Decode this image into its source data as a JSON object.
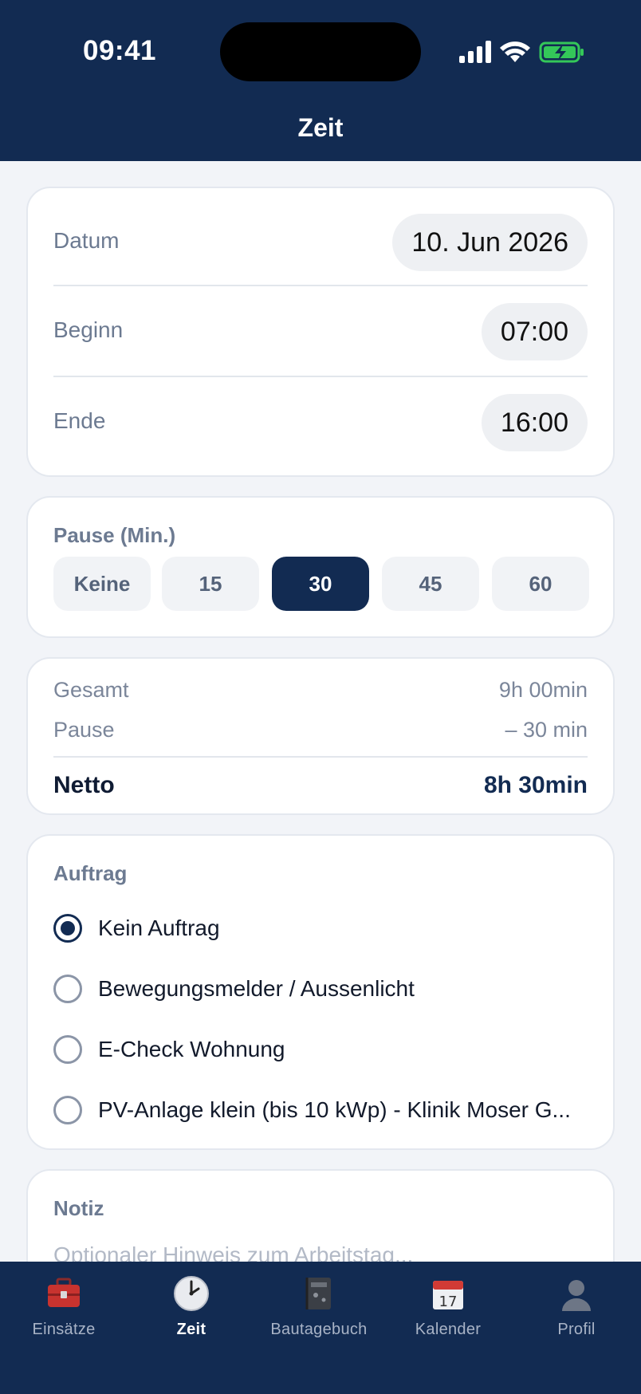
{
  "status_bar": {
    "time": "09:41"
  },
  "header": {
    "title": "Zeit"
  },
  "date_card": {
    "rows": [
      {
        "label": "Datum",
        "value": "10. Jun 2026"
      },
      {
        "label": "Beginn",
        "value": "07:00"
      },
      {
        "label": "Ende",
        "value": "16:00"
      }
    ]
  },
  "pause": {
    "title": "Pause (Min.)",
    "options": [
      "Keine",
      "15",
      "30",
      "45",
      "60"
    ],
    "selected": "30"
  },
  "summary": {
    "total_label": "Gesamt",
    "total_value": "9h 00min",
    "pause_label": "Pause",
    "pause_value": "– 30 min",
    "net_label": "Netto",
    "net_value": "8h 30min"
  },
  "auftrag": {
    "title": "Auftrag",
    "options": [
      "Kein Auftrag",
      "Bewegungsmelder / Aussenlicht",
      "E-Check Wohnung",
      "PV-Anlage klein (bis 10 kWp) - Klinik Moser G..."
    ],
    "selected": "Kein Auftrag"
  },
  "note": {
    "title": "Notiz",
    "placeholder": "Optionaler Hinweis zum Arbeitstag..."
  },
  "tabbar": {
    "tabs": [
      {
        "label": "Einsätze",
        "icon": "toolbox-icon"
      },
      {
        "label": "Zeit",
        "icon": "clock-icon"
      },
      {
        "label": "Bautagebuch",
        "icon": "notebook-icon"
      },
      {
        "label": "Kalender",
        "icon": "calendar-icon"
      },
      {
        "label": "Profil",
        "icon": "person-icon"
      }
    ],
    "active": "Zeit"
  },
  "colors": {
    "primary": "#122b52",
    "background": "#f2f4f8",
    "battery": "#34c759"
  }
}
